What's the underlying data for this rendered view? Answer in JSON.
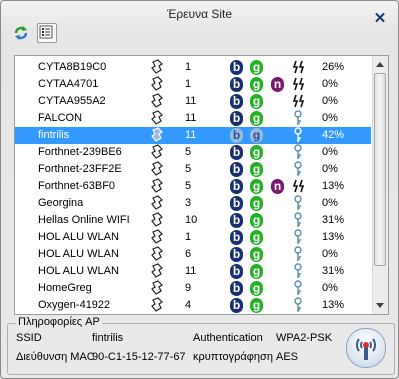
{
  "window": {
    "title": "Έρευνα Site",
    "close_glyph": "✕"
  },
  "toolbar": {
    "refresh_icon": "refresh-icon",
    "list_icon": "list-view-icon"
  },
  "networks": [
    {
      "ssid": "CYTA8B19C0",
      "channel": "1",
      "b": "b",
      "g": "g",
      "n": "",
      "status": "arrows",
      "signal": "26%"
    },
    {
      "ssid": "CYTAA4701",
      "channel": "1",
      "b": "b",
      "g": "g",
      "n": "n",
      "status": "arrows",
      "signal": "0%"
    },
    {
      "ssid": "CYTAA955A2",
      "channel": "11",
      "b": "b",
      "g": "g",
      "n": "",
      "status": "arrows",
      "signal": "0%"
    },
    {
      "ssid": "FALCON",
      "channel": "11",
      "b": "b",
      "g": "g",
      "n": "",
      "status": "key",
      "signal": "0%"
    },
    {
      "ssid": "fintrilis",
      "channel": "11",
      "b": "b",
      "g": "g",
      "n": "",
      "status": "key",
      "signal": "42%",
      "selected": true
    },
    {
      "ssid": "Forthnet-239BE6",
      "channel": "5",
      "b": "b",
      "g": "g",
      "n": "",
      "status": "key",
      "signal": "0%"
    },
    {
      "ssid": "Forthnet-23FF2E",
      "channel": "5",
      "b": "b",
      "g": "g",
      "n": "",
      "status": "key",
      "signal": "0%"
    },
    {
      "ssid": "Forthnet-63BF0",
      "channel": "5",
      "b": "b",
      "g": "g",
      "n": "n",
      "status": "arrows",
      "signal": "13%"
    },
    {
      "ssid": "Georgina",
      "channel": "3",
      "b": "b",
      "g": "g",
      "n": "",
      "status": "key",
      "signal": "0%"
    },
    {
      "ssid": "Hellas Online WIFI",
      "channel": "10",
      "b": "b",
      "g": "g",
      "n": "",
      "status": "key",
      "signal": "31%"
    },
    {
      "ssid": "HOL ALU WLAN",
      "channel": "1",
      "b": "b",
      "g": "g",
      "n": "",
      "status": "key",
      "signal": "13%"
    },
    {
      "ssid": "HOL ALU WLAN",
      "channel": "6",
      "b": "b",
      "g": "g",
      "n": "",
      "status": "key",
      "signal": "0%"
    },
    {
      "ssid": "HOL ALU WLAN",
      "channel": "11",
      "b": "b",
      "g": "g",
      "n": "",
      "status": "key",
      "signal": "31%"
    },
    {
      "ssid": "HomeGreg",
      "channel": "9",
      "b": "b",
      "g": "g",
      "n": "",
      "status": "key",
      "signal": "0%"
    },
    {
      "ssid": "Oxygen-41922",
      "channel": "4",
      "b": "b",
      "g": "g",
      "n": "",
      "status": "key",
      "signal": "13%"
    }
  ],
  "ap_info": {
    "group_title": "Πληροφορίες AP",
    "ssid_label": "SSID",
    "ssid_value": "fintrilis",
    "auth_label": "Authentication",
    "auth_value": "WPA2-PSK",
    "mac_label": "Διεύθυνση MAC",
    "mac_value": "90-C1-15-12-77-67",
    "enc_label": "κρυπτογράφηση",
    "enc_value": "AES"
  },
  "colors": {
    "selection": "#3399ff",
    "b_badge": "#1a2e72",
    "g_badge": "#23b223",
    "n_badge": "#7a1a6a"
  }
}
